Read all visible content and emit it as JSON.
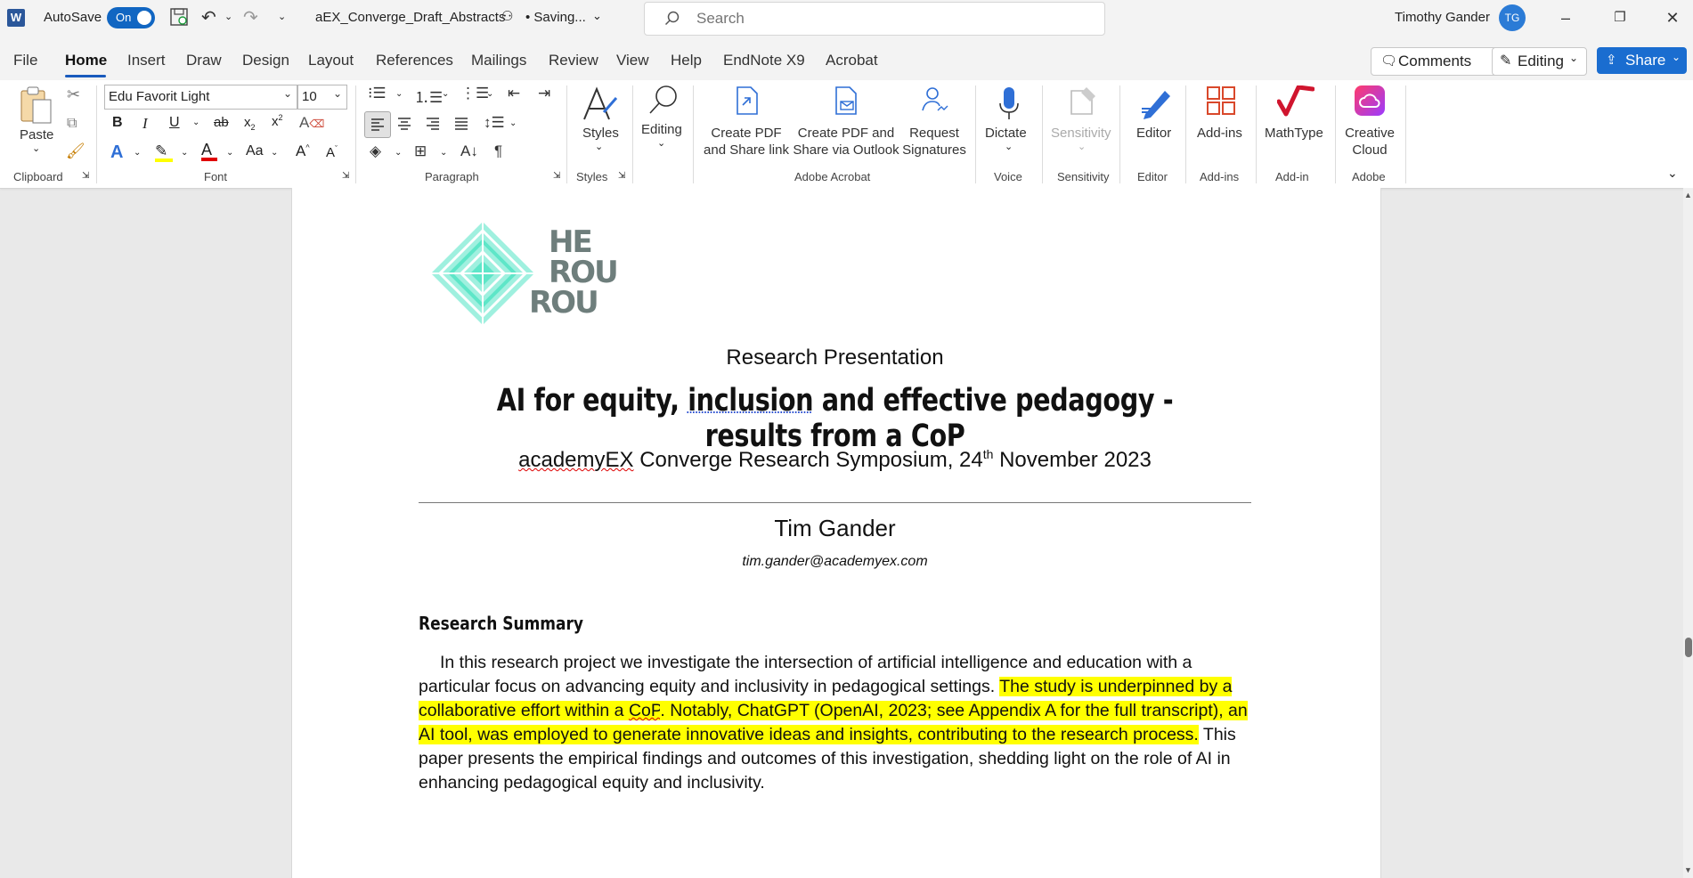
{
  "titlebar": {
    "app_icon": "W",
    "autosave_label": "AutoSave",
    "autosave_state": "On",
    "filename": "aEX_Converge_Draft_Abstracts",
    "status": "• Saving...",
    "search_placeholder": "Search",
    "user_name": "Timothy Gander",
    "user_initials": "TG"
  },
  "menu": {
    "tabs": [
      "File",
      "Home",
      "Insert",
      "Draw",
      "Design",
      "Layout",
      "References",
      "Mailings",
      "Review",
      "View",
      "Help",
      "EndNote X9",
      "Acrobat"
    ],
    "comments_label": "Comments",
    "editing_label": "Editing",
    "share_label": "Share"
  },
  "ribbon": {
    "clipboard": {
      "paste": "Paste",
      "group": "Clipboard"
    },
    "font": {
      "name": "Edu Favorit Light",
      "size": "10",
      "group": "Font"
    },
    "paragraph": {
      "group": "Paragraph"
    },
    "styles": {
      "label": "Styles",
      "group": "Styles"
    },
    "editing": {
      "label": "Editing"
    },
    "acrobat": {
      "create_share_1": "Create PDF",
      "create_share_2": "and Share link",
      "create_outlook_1": "Create PDF and",
      "create_outlook_2": "Share via Outlook",
      "request_1": "Request",
      "request_2": "Signatures",
      "group": "Adobe Acrobat"
    },
    "voice": {
      "label": "Dictate",
      "group": "Voice"
    },
    "sensitivity": {
      "label": "Sensitivity",
      "group": "Sensitivity"
    },
    "editor": {
      "label": "Editor",
      "group": "Editor"
    },
    "addins": {
      "label": "Add-ins",
      "group": "Add-ins"
    },
    "mathtype": {
      "label": "MathType",
      "group": "Add-in"
    },
    "creative": {
      "label_1": "Creative",
      "label_2": "Cloud",
      "group": "Adobe"
    }
  },
  "document": {
    "logo_lines": [
      "HE",
      "ROU",
      "ROU"
    ],
    "presentation_type": "Research Presentation",
    "title_pre": "AI for equity, ",
    "title_link": "inclusion",
    "title_post": " and effective pedagogy - results from a CoP",
    "symposium_a": "academyEX",
    "symposium_b": " Converge Research Symposium, 24",
    "symposium_sup": "th",
    "symposium_c": " November 2023",
    "author": "Tim Gander",
    "email": "tim.gander@academyex.com",
    "summary_heading": "Research Summary",
    "para_1": "In this research project we investigate the intersection of artificial intelligence and education with a particular focus on advancing equity and inclusivity in pedagogical settings. ",
    "para_hl_1": "The study is underpinned by a collaborative effort within a ",
    "para_hl_cop": "CoP",
    "para_hl_2": ". Notably, ChatGPT (OpenAI, 2023; see Appendix A for the full transcript), an AI tool, was employed to generate innovative ideas and insights, contributing to the research process.",
    "para_2": " This paper presents the empirical findings and outcomes of this investigation, shedding light on the role of AI in enhancing pedagogical equity and inclusivity."
  },
  "colors": {
    "accent": "#185abd",
    "share": "#1a6dd0",
    "highlight": "#ffff00",
    "logo_teal": "#5ee6c8",
    "logo_gray": "#6e7e7c"
  }
}
